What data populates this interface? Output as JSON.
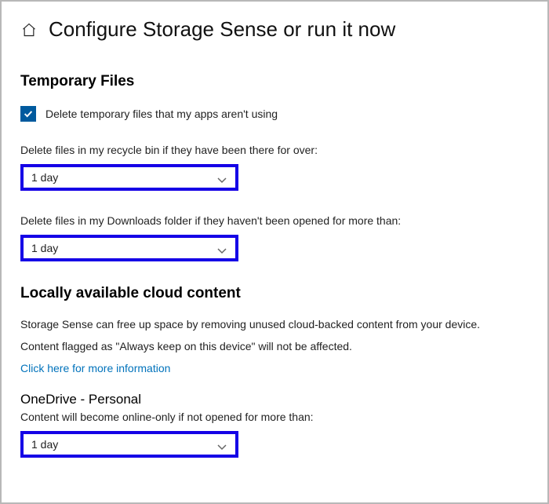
{
  "header": {
    "title": "Configure Storage Sense or run it now"
  },
  "temp": {
    "section_title": "Temporary Files",
    "checkbox_label": "Delete temporary files that my apps aren't using",
    "recycle_label": "Delete files in my recycle bin if they have been there for over:",
    "recycle_value": "1 day",
    "downloads_label": "Delete files in my Downloads folder if they haven't been opened for more than:",
    "downloads_value": "1 day"
  },
  "cloud": {
    "section_title": "Locally available cloud content",
    "desc1": "Storage Sense can free up space by removing unused cloud-backed content from your device.",
    "desc2": "Content flagged as \"Always keep on this device\" will not be affected.",
    "link_text": "Click here for more information",
    "onedrive_title": "OneDrive - Personal",
    "onedrive_label": "Content will become online-only if not opened for more than:",
    "onedrive_value": "1 day"
  }
}
